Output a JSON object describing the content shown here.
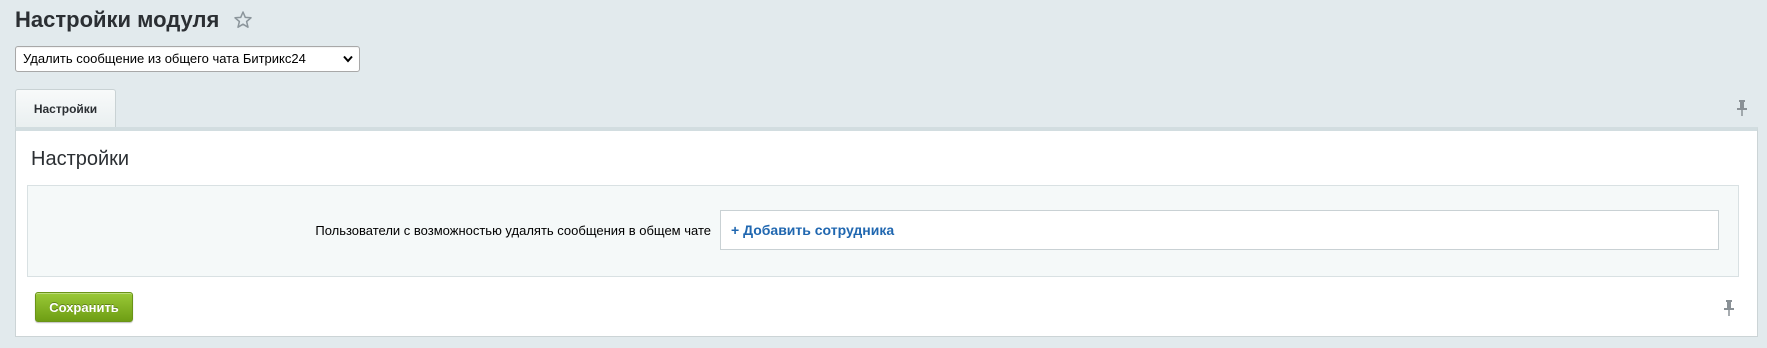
{
  "header": {
    "title": "Настройки модуля",
    "favorite_icon": "star-icon"
  },
  "module_select": {
    "selected": "Удалить сообщение из общего чата Битрикс24"
  },
  "tabs": [
    {
      "label": "Настройки",
      "active": true
    }
  ],
  "panel": {
    "section_title": "Настройки",
    "field_label": "Пользователи с возможностью удалять сообщения в общем чате",
    "add_link": "+ Добавить сотрудника"
  },
  "footer": {
    "save_label": "Сохранить"
  },
  "colors": {
    "background": "#e2eaed",
    "link": "#2067b0",
    "save_button": "#7fb022"
  }
}
